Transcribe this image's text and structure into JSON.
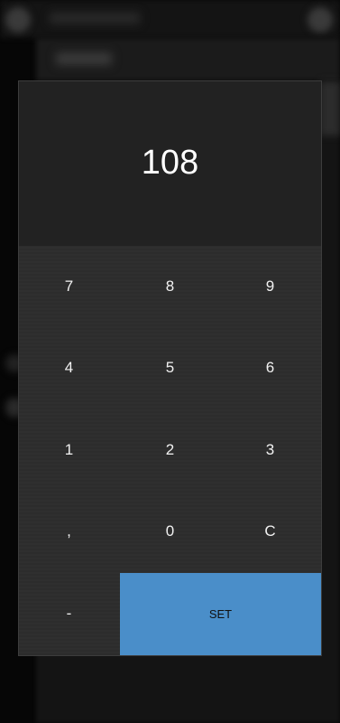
{
  "display": {
    "value": "108"
  },
  "keypad": {
    "keys": [
      {
        "label": "7"
      },
      {
        "label": "8"
      },
      {
        "label": "9"
      },
      {
        "label": "4"
      },
      {
        "label": "5"
      },
      {
        "label": "6"
      },
      {
        "label": "1"
      },
      {
        "label": "2"
      },
      {
        "label": "3"
      },
      {
        "label": ","
      },
      {
        "label": "0"
      },
      {
        "label": "C"
      },
      {
        "label": "-"
      }
    ],
    "set_label": "SET"
  },
  "colors": {
    "accent": "#4a8ec9",
    "panel": "#2b2b2b",
    "display_bg": "#222222"
  }
}
